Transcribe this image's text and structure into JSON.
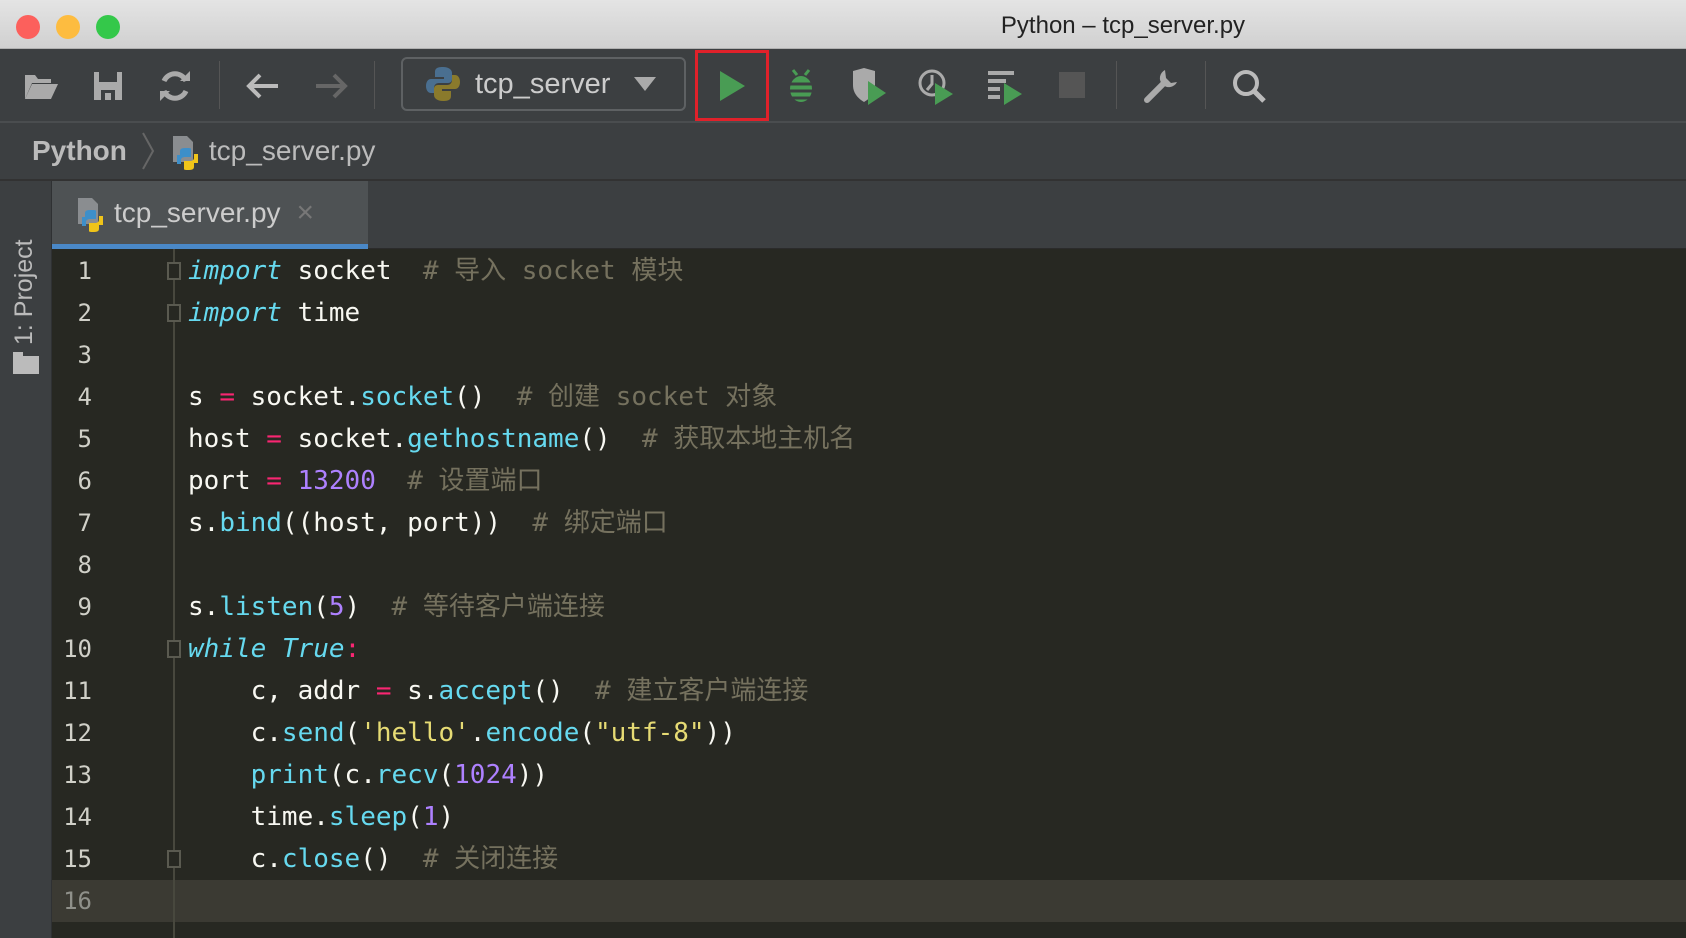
{
  "window": {
    "title": "Python – tcp_server.py"
  },
  "toolbar": {
    "buttons": [
      "open-icon",
      "save-icon",
      "sync-icon",
      "back-icon",
      "forward-icon",
      "run-icon",
      "debug-icon",
      "coverage-icon",
      "profile-icon",
      "concurrency-icon",
      "stop-icon",
      "settings-icon",
      "search-icon"
    ],
    "run_config": "tcp_server"
  },
  "breadcrumb": {
    "project": "Python",
    "file": "tcp_server.py"
  },
  "sidebar": {
    "project_label": "1: Project"
  },
  "tabs": [
    {
      "label": "tcp_server.py",
      "close": "×"
    }
  ],
  "editor": {
    "current_line": 16,
    "lines": [
      {
        "n": "1",
        "t": [
          [
            "import",
            "kw"
          ],
          [
            " socket  ",
            ""
          ],
          [
            "# 导入 socket 模块",
            "cm"
          ]
        ]
      },
      {
        "n": "2",
        "t": [
          [
            "import",
            "kw"
          ],
          [
            " time",
            ""
          ]
        ]
      },
      {
        "n": "3",
        "t": []
      },
      {
        "n": "4",
        "t": [
          [
            "s ",
            ""
          ],
          [
            "=",
            "op"
          ],
          [
            " socket.",
            ""
          ],
          [
            "socket",
            "fn"
          ],
          [
            "()  ",
            ""
          ],
          [
            "# 创建 socket 对象",
            "cm"
          ]
        ]
      },
      {
        "n": "5",
        "t": [
          [
            "host ",
            ""
          ],
          [
            "=",
            "op"
          ],
          [
            " socket.",
            ""
          ],
          [
            "gethostname",
            "fn"
          ],
          [
            "()  ",
            ""
          ],
          [
            "# 获取本地主机名",
            "cm"
          ]
        ]
      },
      {
        "n": "6",
        "t": [
          [
            "port ",
            ""
          ],
          [
            "=",
            "op"
          ],
          [
            " ",
            ""
          ],
          [
            "13200",
            "num"
          ],
          [
            "  ",
            ""
          ],
          [
            "# 设置端口",
            "cm"
          ]
        ]
      },
      {
        "n": "7",
        "t": [
          [
            "s.",
            ""
          ],
          [
            "bind",
            "fn"
          ],
          [
            "((host, port))  ",
            ""
          ],
          [
            "# 绑定端口",
            "cm"
          ]
        ]
      },
      {
        "n": "8",
        "t": []
      },
      {
        "n": "9",
        "t": [
          [
            "s.",
            ""
          ],
          [
            "listen",
            "fn"
          ],
          [
            "(",
            ""
          ],
          [
            "5",
            "num"
          ],
          [
            ")  ",
            ""
          ],
          [
            "# 等待客户端连接",
            "cm"
          ]
        ]
      },
      {
        "n": "10",
        "t": [
          [
            "while",
            "kw"
          ],
          [
            " ",
            ""
          ],
          [
            "True",
            "kw"
          ],
          [
            ":",
            "op"
          ]
        ]
      },
      {
        "n": "11",
        "t": [
          [
            "    c, addr ",
            ""
          ],
          [
            "=",
            "op"
          ],
          [
            " s.",
            ""
          ],
          [
            "accept",
            "fn"
          ],
          [
            "()  ",
            ""
          ],
          [
            "# 建立客户端连接",
            "cm"
          ]
        ]
      },
      {
        "n": "12",
        "t": [
          [
            "    c.",
            ""
          ],
          [
            "send",
            "fn"
          ],
          [
            "(",
            ""
          ],
          [
            "'hello'",
            "str"
          ],
          [
            ".",
            ""
          ],
          [
            "encode",
            "fn"
          ],
          [
            "(",
            ""
          ],
          [
            "\"utf-8\"",
            "str"
          ],
          [
            "))",
            ""
          ]
        ]
      },
      {
        "n": "13",
        "t": [
          [
            "    ",
            ""
          ],
          [
            "print",
            "fn"
          ],
          [
            "(c.",
            ""
          ],
          [
            "recv",
            "fn"
          ],
          [
            "(",
            ""
          ],
          [
            "1024",
            "num"
          ],
          [
            "))",
            ""
          ]
        ]
      },
      {
        "n": "14",
        "t": [
          [
            "    time.",
            ""
          ],
          [
            "sleep",
            "fn"
          ],
          [
            "(",
            ""
          ],
          [
            "1",
            "num"
          ],
          [
            ")",
            ""
          ]
        ]
      },
      {
        "n": "15",
        "t": [
          [
            "    c.",
            ""
          ],
          [
            "close",
            "fn"
          ],
          [
            "()  ",
            ""
          ],
          [
            "# 关闭连接",
            "cm"
          ]
        ]
      },
      {
        "n": "16",
        "t": []
      }
    ]
  },
  "colors": {
    "accent": "#4a88c7",
    "run_green": "#499c54",
    "highlight_border": "#e0212a",
    "editor_bg": "#272822"
  }
}
